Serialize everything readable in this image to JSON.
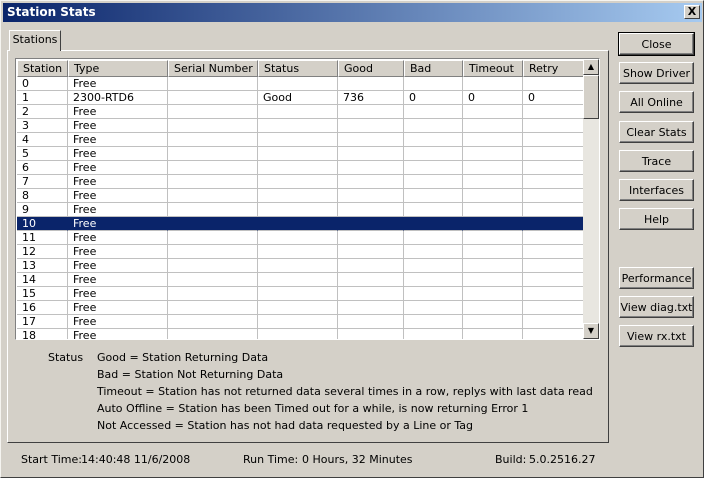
{
  "window": {
    "title": "Station Stats",
    "close_glyph": "X"
  },
  "tabs": [
    {
      "label": "Stations"
    }
  ],
  "table": {
    "columns": [
      "Station",
      "Type",
      "Serial Number",
      "Status",
      "Good",
      "Bad",
      "Timeout",
      "Retry"
    ],
    "selected_station": "10",
    "rows": [
      [
        "0",
        "Free",
        "",
        "",
        "",
        "",
        "",
        ""
      ],
      [
        "1",
        "2300-RTD6",
        "",
        "Good",
        "736",
        "0",
        "0",
        "0"
      ],
      [
        "2",
        "Free",
        "",
        "",
        "",
        "",
        "",
        ""
      ],
      [
        "3",
        "Free",
        "",
        "",
        "",
        "",
        "",
        ""
      ],
      [
        "4",
        "Free",
        "",
        "",
        "",
        "",
        "",
        ""
      ],
      [
        "5",
        "Free",
        "",
        "",
        "",
        "",
        "",
        ""
      ],
      [
        "6",
        "Free",
        "",
        "",
        "",
        "",
        "",
        ""
      ],
      [
        "7",
        "Free",
        "",
        "",
        "",
        "",
        "",
        ""
      ],
      [
        "8",
        "Free",
        "",
        "",
        "",
        "",
        "",
        ""
      ],
      [
        "9",
        "Free",
        "",
        "",
        "",
        "",
        "",
        ""
      ],
      [
        "10",
        "Free",
        "",
        "",
        "",
        "",
        "",
        ""
      ],
      [
        "11",
        "Free",
        "",
        "",
        "",
        "",
        "",
        ""
      ],
      [
        "12",
        "Free",
        "",
        "",
        "",
        "",
        "",
        ""
      ],
      [
        "13",
        "Free",
        "",
        "",
        "",
        "",
        "",
        ""
      ],
      [
        "14",
        "Free",
        "",
        "",
        "",
        "",
        "",
        ""
      ],
      [
        "15",
        "Free",
        "",
        "",
        "",
        "",
        "",
        ""
      ],
      [
        "16",
        "Free",
        "",
        "",
        "",
        "",
        "",
        ""
      ],
      [
        "17",
        "Free",
        "",
        "",
        "",
        "",
        "",
        ""
      ],
      [
        "18",
        "Free",
        "",
        "",
        "",
        "",
        "",
        ""
      ]
    ]
  },
  "legend": {
    "label": "Status",
    "lines": [
      "Good = Station Returning Data",
      "Bad = Station Not Returning Data",
      "Timeout = Station has not returned data several times in a row, replys with last data read",
      "Auto Offline = Station has been Timed out for a while, is now returning Error 1",
      "Not Accessed = Station has not had data requested by a Line or Tag"
    ]
  },
  "buttons": {
    "close": "Close",
    "show_driver": "Show Driver",
    "all_online": "All Online",
    "clear_stats": "Clear Stats",
    "trace": "Trace",
    "interfaces": "Interfaces",
    "help": "Help",
    "performance": "Performance",
    "view_diag": "View diag.txt",
    "view_rx": "View rx.txt"
  },
  "status_bar": {
    "start_label": "Start Time:",
    "start_value": "14:40:48 11/6/2008",
    "run_label": "Run Time:",
    "run_value": "0 Hours, 32 Minutes",
    "build_label": "Build:",
    "build_value": "5.0.2516.27"
  },
  "colors": {
    "selection": "#0a246a",
    "face": "#d4d0c8"
  },
  "icons": {
    "scroll_up": "scroll-up-arrow-icon",
    "scroll_down": "scroll-down-arrow-icon"
  }
}
